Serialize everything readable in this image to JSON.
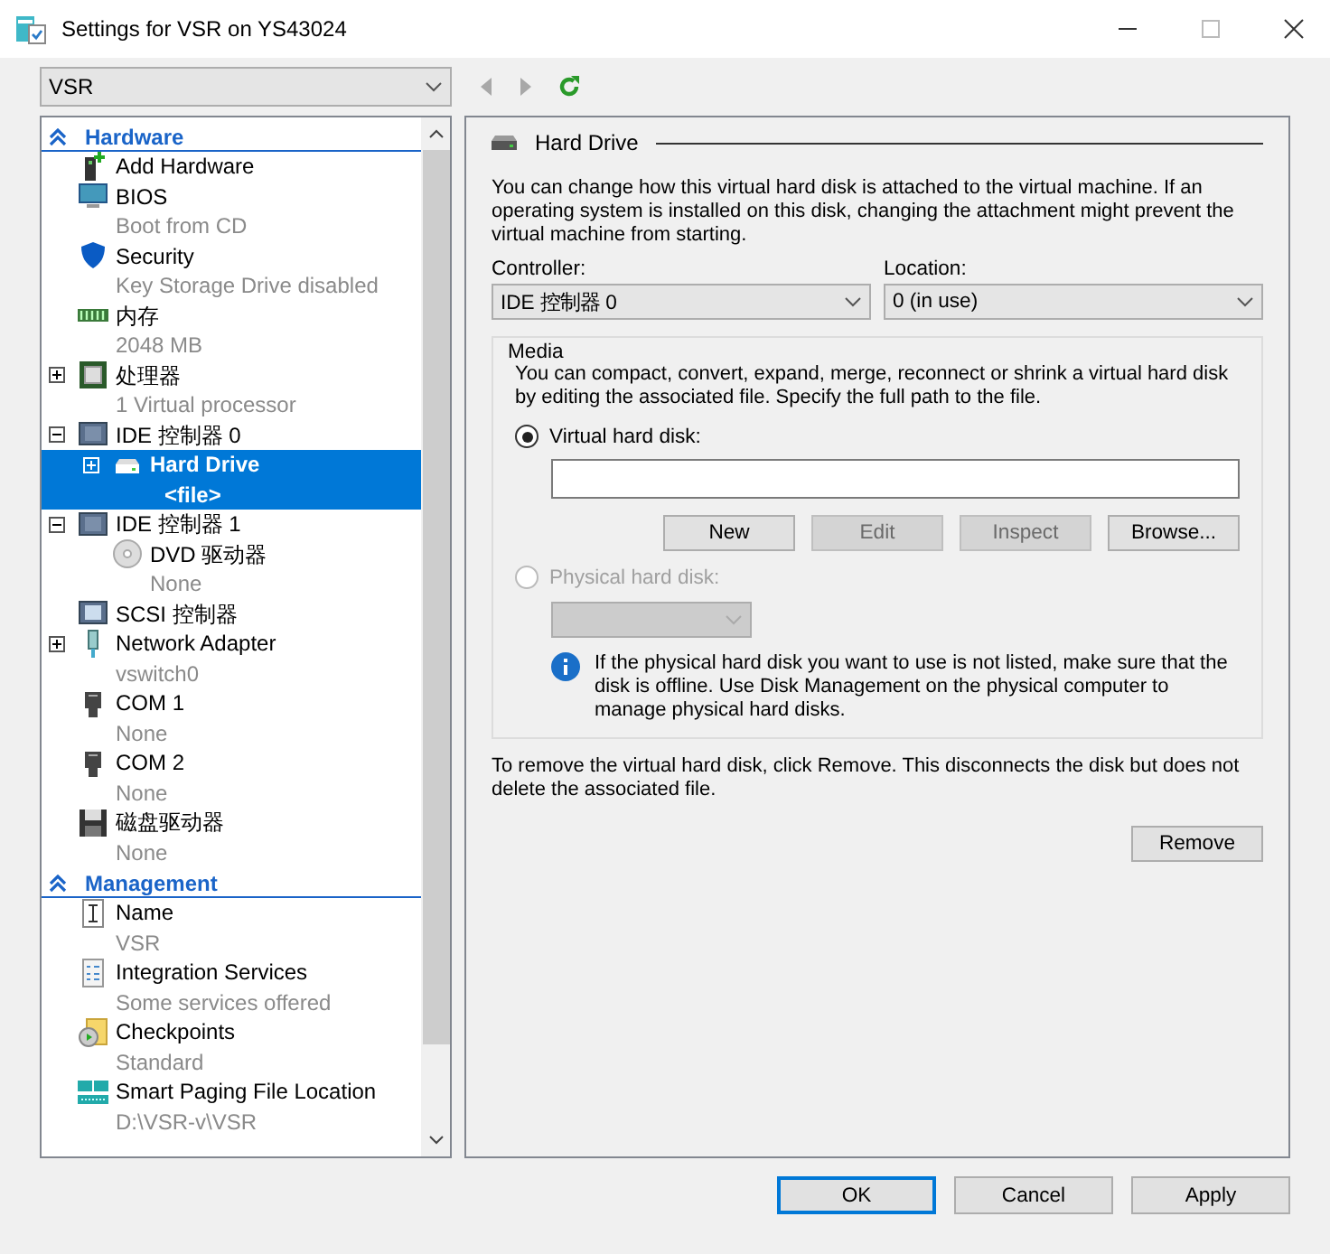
{
  "window": {
    "title": "Settings for VSR on YS43024"
  },
  "vm_select": {
    "value": "VSR"
  },
  "tree": [
    {
      "kind": "section",
      "label": "Hardware",
      "expanded": true,
      "children": [
        {
          "kind": "add-hardware",
          "label": "Add Hardware",
          "selected": false
        },
        {
          "kind": "monitor",
          "label": "BIOS",
          "detail": "Boot from CD",
          "selected": false
        },
        {
          "kind": "shield",
          "label": "Security",
          "detail": "Key Storage Drive disabled",
          "selected": false
        },
        {
          "kind": "memory",
          "label": "内存",
          "detail": "2048 MB",
          "selected": false
        },
        {
          "kind": "cpu",
          "label": "处理器",
          "detail": "1 Virtual processor",
          "expanded": false,
          "selected": false
        },
        {
          "kind": "controller",
          "label": "IDE 控制器 0",
          "expanded": true,
          "selected": false,
          "children": [
            {
              "kind": "disk",
              "label": "Hard Drive",
              "detail": "<file>",
              "expanded": false,
              "selected": true
            }
          ]
        },
        {
          "kind": "controller",
          "label": "IDE 控制器 1",
          "expanded": true,
          "selected": false,
          "children": [
            {
              "kind": "dvd",
              "label": "DVD 驱动器",
              "detail": "None",
              "selected": false
            }
          ]
        },
        {
          "kind": "scsi",
          "label": "SCSI 控制器",
          "selected": false
        },
        {
          "kind": "network",
          "label": "Network Adapter",
          "detail": "vswitch0",
          "expanded": false,
          "selected": false
        },
        {
          "kind": "com",
          "label": "COM 1",
          "detail": "None",
          "selected": false
        },
        {
          "kind": "com",
          "label": "COM 2",
          "detail": "None",
          "selected": false
        },
        {
          "kind": "floppy",
          "label": "磁盘驱动器",
          "detail": "None",
          "selected": false
        }
      ]
    },
    {
      "kind": "section",
      "label": "Management",
      "expanded": true,
      "children": [
        {
          "kind": "name",
          "label": "Name",
          "detail": "VSR",
          "selected": false
        },
        {
          "kind": "services",
          "label": "Integration Services",
          "detail": "Some services offered",
          "selected": false
        },
        {
          "kind": "checkpoint",
          "label": "Checkpoints",
          "detail": "Standard",
          "selected": false
        },
        {
          "kind": "paging",
          "label": "Smart Paging File Location",
          "detail": "D:\\VSR-v\\VSR",
          "selected": false
        }
      ]
    }
  ],
  "panel": {
    "title": "Hard Drive",
    "intro": "You can change how this virtual hard disk is attached to the virtual machine. If an operating system is installed on this disk, changing the attachment might prevent the virtual machine from starting.",
    "controller": {
      "label": "Controller:",
      "value": "IDE 控制器 0"
    },
    "location": {
      "label": "Location:",
      "value": "0 (in use)"
    },
    "media": {
      "title": "Media",
      "text": "You can compact, convert, expand, merge, reconnect or shrink a virtual hard disk by editing the associated file. Specify the full path to the file.",
      "virtual": {
        "label": "Virtual hard disk:",
        "selected": true,
        "disabled": false
      },
      "buttons": [
        {
          "label": "New",
          "disabled": false
        },
        {
          "label": "Edit",
          "disabled": true
        },
        {
          "label": "Inspect",
          "disabled": true
        },
        {
          "label": "Browse...",
          "disabled": false
        }
      ],
      "physical": {
        "label": "Physical hard disk:",
        "selected": false,
        "disabled": true
      },
      "info": "If the physical hard disk you want to use is not listed, make sure that the disk is offline. Use Disk Management on the physical computer to manage physical hard disks."
    },
    "remove_text": "To remove the virtual hard disk, click Remove. This disconnects the disk but does not delete the associated file.",
    "remove_button": "Remove"
  },
  "dialog_buttons": [
    {
      "label": "OK",
      "default": true
    },
    {
      "label": "Cancel",
      "default": false
    },
    {
      "label": "Apply",
      "default": false
    }
  ]
}
